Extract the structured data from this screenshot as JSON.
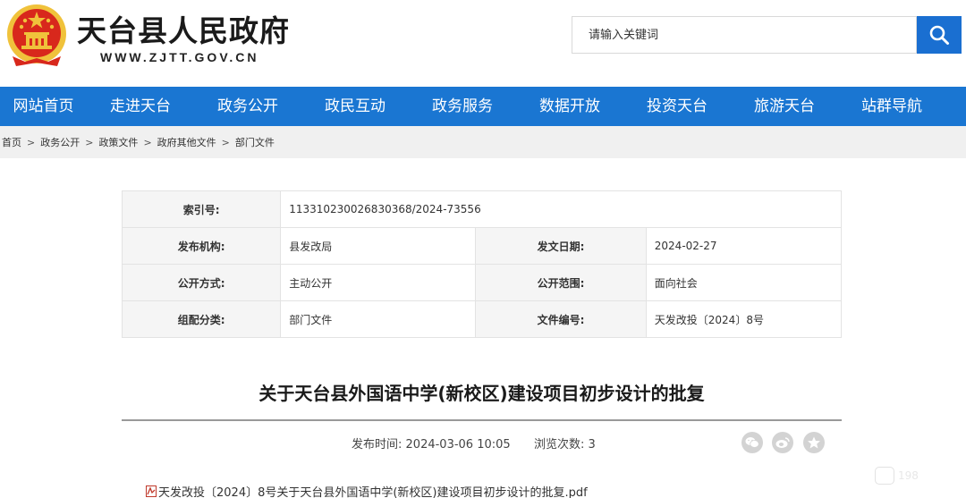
{
  "header": {
    "site_title": "天台县人民政府",
    "site_url": "WWW.ZJTT.GOV.CN",
    "search_placeholder": "请输入关键词"
  },
  "nav": {
    "items": [
      "网站首页",
      "走进天台",
      "政务公开",
      "政民互动",
      "政务服务",
      "数据开放",
      "投资天台",
      "旅游天台",
      "站群导航"
    ]
  },
  "breadcrumb": {
    "items": [
      "首页",
      "政务公开",
      "政策文件",
      "政府其他文件",
      "部门文件"
    ],
    "separator": ">"
  },
  "meta": {
    "index_label": "索引号:",
    "index_value": "113310230026830368/2024-73556",
    "publisher_label": "发布机构:",
    "publisher_value": "县发改局",
    "issue_date_label": "发文日期:",
    "issue_date_value": "2024-02-27",
    "disclosure_label": "公开方式:",
    "disclosure_value": "主动公开",
    "scope_label": "公开范围:",
    "scope_value": "面向社会",
    "category_label": "组配分类:",
    "category_value": "部门文件",
    "doc_no_label": "文件编号:",
    "doc_no_value": "天发改投〔2024〕8号"
  },
  "article": {
    "title": "关于天台县外国语中学(新校区)建设项目初步设计的批复",
    "publish_time_label": "发布时间:",
    "publish_time": "2024-03-06 10:05",
    "views_label": "浏览次数:",
    "views": "3",
    "attachment": "天发改投〔2024〕8号关于天台县外国语中学(新校区)建设项目初步设计的批复.pdf"
  },
  "share_icons": [
    "wechat-icon",
    "weibo-icon",
    "favorite-icon"
  ],
  "watermark": "198",
  "colors": {
    "nav_bg": "#1a76d2",
    "search_btn": "#1a6fd1",
    "emblem_red": "#d8281c",
    "emblem_gold": "#f0c23b"
  }
}
